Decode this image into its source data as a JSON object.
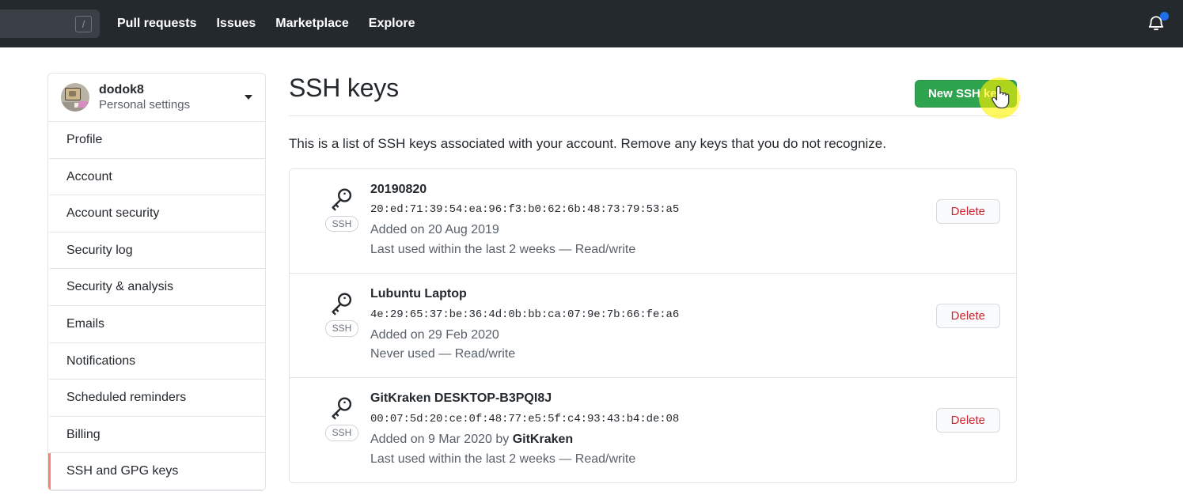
{
  "header": {
    "search": {
      "placeholder": "",
      "value": "",
      "shortcut_badge": "/"
    },
    "nav": [
      {
        "label": "Pull requests",
        "name": "nav-pull-requests"
      },
      {
        "label": "Issues",
        "name": "nav-issues"
      },
      {
        "label": "Marketplace",
        "name": "nav-marketplace"
      },
      {
        "label": "Explore",
        "name": "nav-explore"
      }
    ],
    "notifications_icon": "bell-icon",
    "has_unread": true,
    "bg_color": "#24292e",
    "unread_dot_color": "#1f6feb"
  },
  "sidebar": {
    "profile": {
      "username": "dodok8",
      "subtitle": "Personal settings",
      "avatar_icon": "avatar",
      "caret_icon": "chevron-down-icon"
    },
    "items": [
      {
        "label": "Profile",
        "active": false
      },
      {
        "label": "Account",
        "active": false
      },
      {
        "label": "Account security",
        "active": false
      },
      {
        "label": "Security log",
        "active": false
      },
      {
        "label": "Security & analysis",
        "active": false
      },
      {
        "label": "Emails",
        "active": false
      },
      {
        "label": "Notifications",
        "active": false
      },
      {
        "label": "Scheduled reminders",
        "active": false
      },
      {
        "label": "Billing",
        "active": false
      },
      {
        "label": "SSH and GPG keys",
        "active": true
      }
    ],
    "active_indicator_color": "#f9826c"
  },
  "main": {
    "title": "SSH keys",
    "new_key_button": "New SSH key",
    "new_key_button_color": "#2ea44f",
    "intro": "This is a list of SSH keys associated with your account. Remove any keys that you do not recognize.",
    "delete_label": "Delete",
    "delete_text_color": "#cb2431",
    "badge_label": "SSH",
    "key_icon": "key-icon",
    "keys": [
      {
        "title": "20190820",
        "fingerprint": "20:ed:71:39:54:ea:96:f3:b0:62:6b:48:73:79:53:a5",
        "added": "Added on 20 Aug 2019",
        "added_by": "",
        "usage": "Last used within the last 2 weeks — Read/write"
      },
      {
        "title": "Lubuntu Laptop",
        "fingerprint": "4e:29:65:37:be:36:4d:0b:bb:ca:07:9e:7b:66:fe:a6",
        "added": "Added on 29 Feb 2020",
        "added_by": "",
        "usage": "Never used — Read/write"
      },
      {
        "title": "GitKraken DESKTOP-B3PQI8J",
        "fingerprint": "00:07:5d:20:ce:0f:48:77:e5:5f:c4:93:43:b4:de:08",
        "added": "Added on 9 Mar 2020 by ",
        "added_by": "GitKraken",
        "usage": "Last used within the last 2 weeks — Read/write"
      }
    ]
  },
  "cursor": {
    "icon": "pointer-hand-cursor",
    "highlight_color": "#fff200",
    "target": "New SSH key"
  }
}
